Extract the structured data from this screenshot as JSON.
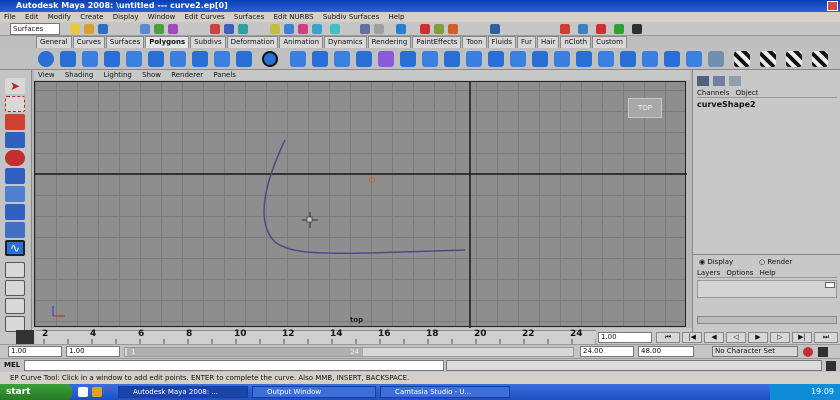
{
  "window": {
    "title": "Autodesk Maya 2008: \\untitled   ---   curve2.ep[0]"
  },
  "menubar": {
    "items": [
      "File",
      "Edit",
      "Modify",
      "Create",
      "Display",
      "Window",
      "Edit Curves",
      "Surfaces",
      "Edit NURBS",
      "Subdiv Surfaces",
      "Help"
    ]
  },
  "status_line": {
    "mode_value": "Surfaces"
  },
  "shelf": {
    "tabs": [
      "General",
      "Curves",
      "Surfaces",
      "Polygons",
      "Subdivs",
      "Deformation",
      "Animation",
      "Dynamics",
      "Rendering",
      "PaintEffects",
      "Toon",
      "Fluids",
      "Fur",
      "Hair",
      "nCloth",
      "Custom"
    ],
    "active_tab": "Polygons"
  },
  "panel_menu": {
    "items": [
      "View",
      "Shading",
      "Lighting",
      "Show",
      "Renderer",
      "Panels"
    ]
  },
  "viewport": {
    "camera_badge": "TOP",
    "camera_label": "top",
    "curve_color": "#4a4a8a",
    "axis_color": "#1a1a1a",
    "point_color": "#d46010"
  },
  "channel_box": {
    "menu_items": [
      "Channels",
      "Object"
    ],
    "object_name": "curveShape2"
  },
  "layer_editor": {
    "display_option": "Display",
    "render_option": "Render",
    "menu_items": [
      "Layers",
      "Options",
      "Help"
    ]
  },
  "timeline": {
    "ticks": [
      "2",
      "4",
      "6",
      "8",
      "10",
      "12",
      "14",
      "16",
      "18",
      "20",
      "22",
      "24"
    ],
    "current_frame": "1.00"
  },
  "range_slider": {
    "start_time": "1.00",
    "playback_start": "1.00",
    "range_start_label": "1",
    "range_end_label": "24",
    "playback_end": "24.00",
    "end_time": "48.00",
    "character_set": "No Character Set"
  },
  "command_line": {
    "label": "MEL"
  },
  "help_line": {
    "text": "EP Curve Tool: Click in a window to add edit points. ENTER to complete the curve. Also MMB, INSERT, BACKSPACE."
  },
  "taskbar": {
    "start_label": "start",
    "buttons": [
      "Autodesk Maya 2008: ...",
      "Output Window",
      "Camtasia Studio - U..."
    ],
    "clock": "19:09"
  }
}
